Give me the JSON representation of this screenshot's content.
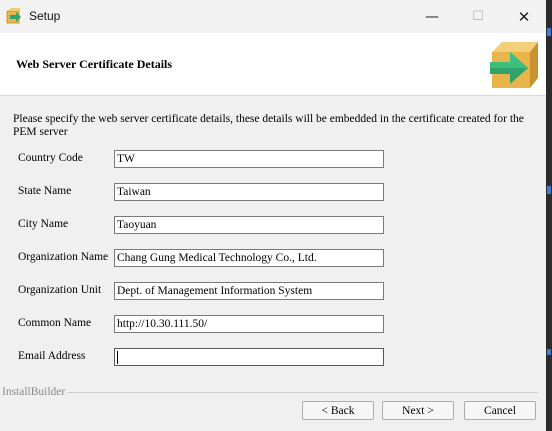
{
  "window": {
    "title": "Setup",
    "minimize_glyph": "—",
    "maximize_glyph": "☐",
    "close_glyph": "✕"
  },
  "header": {
    "title": "Web Server Certificate Details",
    "logo_icon": "installer-box-arrow-icon"
  },
  "description": "Please specify the web server certificate details, these details will be embedded in the certificate created for the PEM server",
  "fields": [
    {
      "label": "Country Code",
      "value": "TW"
    },
    {
      "label": "State Name",
      "value": "Taiwan"
    },
    {
      "label": "City Name",
      "value": "Taoyuan"
    },
    {
      "label": "Organization Name",
      "value": "Chang Gung Medical Technology Co., Ltd."
    },
    {
      "label": "Organization Unit",
      "value": "Dept. of Management Information System"
    },
    {
      "label": "Common Name",
      "value": "http://10.30.111.50/"
    },
    {
      "label": "Email Address",
      "value": ""
    }
  ],
  "footer": {
    "brand": "InstallBuilder",
    "back_label": "< Back",
    "next_label": "Next >",
    "cancel_label": "Cancel"
  },
  "colors": {
    "logo_box": "#e8b54a",
    "logo_arrow": "#2fa36b",
    "window_bg": "#f0f0f0",
    "header_bg": "#ffffff"
  }
}
